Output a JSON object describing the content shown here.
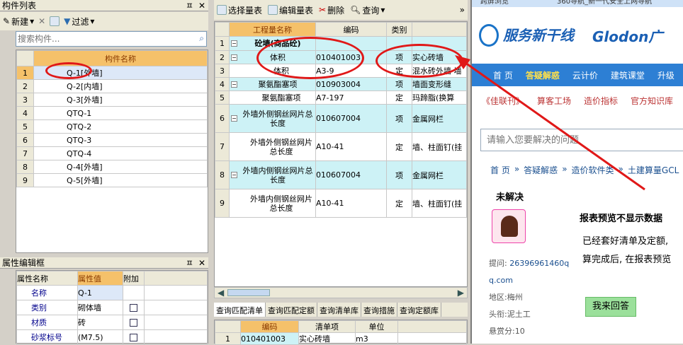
{
  "left_panel": {
    "title": "构件列表",
    "toolbar": {
      "new_label": "新建",
      "filter_label": "过滤"
    },
    "search_placeholder": "搜索构件...",
    "column_header": "构件名称",
    "rows": [
      {
        "num": "1",
        "name": "Q-1[外墙]"
      },
      {
        "num": "2",
        "name": "Q-2[内墙]"
      },
      {
        "num": "3",
        "name": "Q-3[外墙]"
      },
      {
        "num": "4",
        "name": "QTQ-1"
      },
      {
        "num": "5",
        "name": "QTQ-2"
      },
      {
        "num": "6",
        "name": "QTQ-3"
      },
      {
        "num": "7",
        "name": "QTQ-4"
      },
      {
        "num": "8",
        "name": "Q-4[外墙]"
      },
      {
        "num": "9",
        "name": "Q-5[外墙]"
      }
    ]
  },
  "props_panel": {
    "title": "属性编辑框",
    "headers": [
      "属性名称",
      "属性值",
      "附加"
    ],
    "rows": [
      {
        "name": "名称",
        "value": "Q-1"
      },
      {
        "name": "类别",
        "value": "砌体墙"
      },
      {
        "name": "材质",
        "value": "砖"
      },
      {
        "name": "砂浆标号",
        "value": "(M7.5)"
      }
    ]
  },
  "middle_panel": {
    "toolbar": {
      "select": "选择量表",
      "edit": "编辑量表",
      "delete": "删除",
      "query": "查询"
    },
    "headers": [
      "工程量名称",
      "编码",
      "类别",
      ""
    ],
    "rows": [
      {
        "num": "1",
        "name": "砼墙(商品砼)",
        "code": "",
        "cat": "",
        "item": ""
      },
      {
        "num": "2",
        "name": "体积",
        "code": "010401003",
        "cat": "项",
        "item": "实心砖墙"
      },
      {
        "num": "3",
        "name": "体积",
        "code": "A3-9",
        "cat": "定",
        "item": "混水砖外墙 墙"
      },
      {
        "num": "4",
        "name": "聚氨酯塞项",
        "code": "010903004",
        "cat": "项",
        "item": "墙面变形缝"
      },
      {
        "num": "5",
        "name": "聚氨酯塞项",
        "code": "A7-197",
        "cat": "定",
        "item": "玛蹄脂(换算"
      },
      {
        "num": "6",
        "name": "外墙外侧钢丝网片总长度",
        "code": "010607004",
        "cat": "项",
        "item": "金属网栏"
      },
      {
        "num": "7",
        "name": "外墙外侧钢丝网片总长度",
        "code": "A10-41",
        "cat": "定",
        "item": "墙、柱面钉(挂"
      },
      {
        "num": "8",
        "name": "外墙内侧钢丝网片总长度",
        "code": "010607004",
        "cat": "项",
        "item": "金属网栏"
      },
      {
        "num": "9",
        "name": "外墙内侧钢丝网片总长度",
        "code": "A10-41",
        "cat": "定",
        "item": "墙、柱面钉(挂"
      }
    ],
    "tabs": [
      "查询匹配清单",
      "查询匹配定额",
      "查询清单库",
      "查询措施",
      "查询定额库"
    ],
    "bottom_headers": [
      "编码",
      "清单项",
      "单位"
    ],
    "bottom_rows": [
      {
        "num": "1",
        "code": "010401003",
        "item": "实心砖墙",
        "unit": "m3"
      }
    ]
  },
  "browser": {
    "tabs": [
      "跨屏浏览",
      "360导航_新一代安全上网导航"
    ],
    "logo_text": "服务新干线",
    "brand": "Glodon广",
    "nav": [
      "首 页",
      "答疑解惑",
      "云计价",
      "建筑课堂",
      "升级"
    ],
    "links": [
      "《佳联刊》",
      "算客工场",
      "造价指标",
      "官方知识库"
    ],
    "search_placeholder": "请输入您要解决的问题",
    "breadcrumb": [
      "首 页",
      "答疑解惑",
      "造价软件类",
      "土建算量GCL"
    ],
    "status": "未解决",
    "question_title": "报表预览不显示数据",
    "question_body_1": "已经套好清单及定额,",
    "question_body_2": "算完成后, 在报表预览",
    "asker_label": "提问:",
    "asker": "26396961460q",
    "asker_domain": "q.com",
    "region": "地区:梅州",
    "rank": "头衔:泥土工",
    "reward": "悬赏分:10",
    "answer_button": "我来回答",
    "accent": "#2d7fd4"
  }
}
